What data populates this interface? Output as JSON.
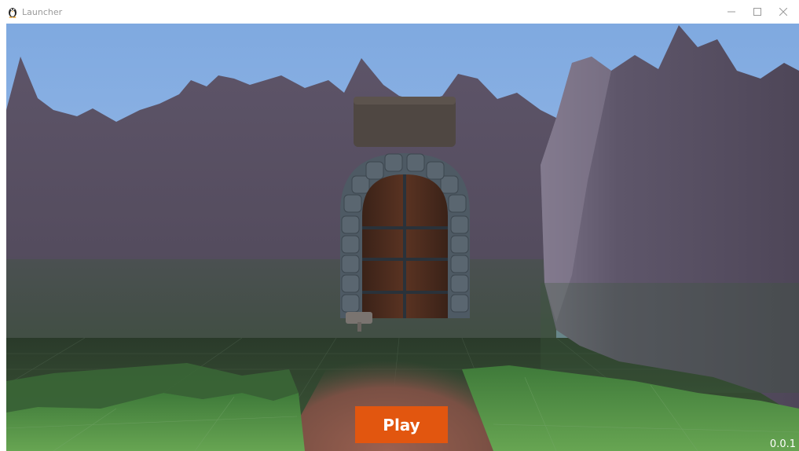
{
  "window": {
    "title": "Launcher",
    "icons": {
      "app": "penguin-icon",
      "minimize": "minimize-icon",
      "maximize": "maximize-icon",
      "close": "close-icon"
    }
  },
  "launcher": {
    "play_label": "Play",
    "version": "0.0.1"
  },
  "colors": {
    "play_button": "#e2560f",
    "sky": "#8ab4e6",
    "cliff": "#5a5264",
    "grass": "#5c9a4c",
    "path": "#8a5a48"
  }
}
